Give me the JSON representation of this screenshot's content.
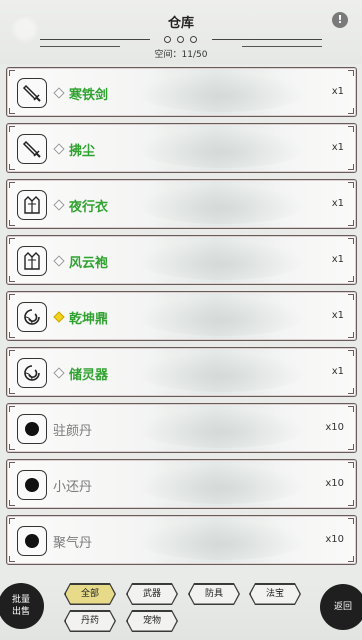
{
  "header": {
    "title": "仓库",
    "capacity_label": "空间：",
    "capacity_value": "11/50",
    "info_symbol": "!"
  },
  "items": [
    {
      "name": "寒铁剑",
      "qty": "x1",
      "icon": "sword-icon",
      "rarity_color": "#2fa22f",
      "marker": "diamond-outline"
    },
    {
      "name": "拂尘",
      "qty": "x1",
      "icon": "sword-icon",
      "rarity_color": "#2fa22f",
      "marker": "diamond-outline"
    },
    {
      "name": "夜行衣",
      "qty": "x1",
      "icon": "robe-icon",
      "rarity_color": "#2fa22f",
      "marker": "diamond-outline"
    },
    {
      "name": "风云袍",
      "qty": "x1",
      "icon": "robe-icon",
      "rarity_color": "#2fa22f",
      "marker": "diamond-outline"
    },
    {
      "name": "乾坤鼎",
      "qty": "x1",
      "icon": "swirl-icon",
      "rarity_color": "#2fa22f",
      "marker": "diamond-gold"
    },
    {
      "name": "储灵器",
      "qty": "x1",
      "icon": "swirl-icon",
      "rarity_color": "#2fa22f",
      "marker": "diamond-outline"
    },
    {
      "name": "驻颜丹",
      "qty": "x10",
      "icon": "pill-icon",
      "rarity_color": "#7a7a7a",
      "marker": "none"
    },
    {
      "name": "小还丹",
      "qty": "x10",
      "icon": "pill-icon",
      "rarity_color": "#7a7a7a",
      "marker": "none"
    },
    {
      "name": "聚气丹",
      "qty": "x10",
      "icon": "pill-icon",
      "rarity_color": "#7a7a7a",
      "marker": "none"
    }
  ],
  "bottom": {
    "bulk_sell_line1": "批量",
    "bulk_sell_line2": "出售",
    "back_label": "返回",
    "tabs": [
      {
        "label": "全部",
        "active": true
      },
      {
        "label": "武器",
        "active": false
      },
      {
        "label": "防具",
        "active": false
      },
      {
        "label": "法宝",
        "active": false
      },
      {
        "label": "丹药",
        "active": false
      },
      {
        "label": "宠物",
        "active": false
      }
    ]
  }
}
